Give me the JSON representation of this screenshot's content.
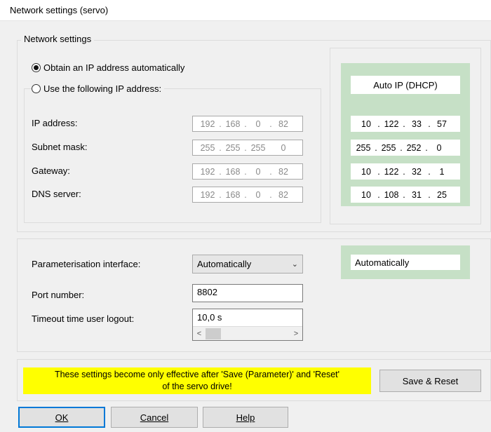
{
  "window": {
    "title": "Network settings (servo)"
  },
  "network": {
    "legend": "Network settings",
    "radio_auto": "Obtain an IP address automatically",
    "radio_manual": "Use the following IP address:",
    "selected": "auto",
    "fields": [
      {
        "label": "IP address:",
        "value": [
          "192",
          "168",
          "0",
          "82"
        ]
      },
      {
        "label": "Subnet mask:",
        "value": [
          "255",
          "255",
          "255",
          "0"
        ]
      },
      {
        "label": "Gateway:",
        "value": [
          "192",
          "168",
          "0",
          "82"
        ]
      },
      {
        "label": "DNS server:",
        "value": [
          "192",
          "168",
          "0",
          "82"
        ]
      }
    ],
    "auto_panel": {
      "title": "Auto IP (DHCP)",
      "values": [
        [
          "10",
          "122",
          "33",
          "57"
        ],
        [
          "255",
          "255",
          "252",
          "0"
        ],
        [
          "10",
          "122",
          "32",
          "1"
        ],
        [
          "10",
          "108",
          "31",
          "25"
        ]
      ]
    }
  },
  "params": {
    "interface_label": "Parameterisation interface:",
    "interface_value": "Automatically",
    "interface_status": "Automatically",
    "port_label": "Port number:",
    "port_value": "8802",
    "timeout_label": "Timeout time user logout:",
    "timeout_value": "10,0 s"
  },
  "notice": {
    "line1": "These settings become only effective after 'Save (Parameter)' and 'Reset'",
    "line2": "of the servo drive!"
  },
  "buttons": {
    "save_reset": "Save & Reset",
    "ok": "OK",
    "cancel": "Cancel",
    "help": "Help"
  },
  "colors": {
    "green_panel": "#c6e0c6",
    "notice_bg": "#ffff00",
    "focus_border": "#0078d7"
  },
  "icons": {
    "dropdown": "chevron-down-icon",
    "scroll_left": "chevron-left-icon",
    "scroll_right": "chevron-right-icon"
  }
}
